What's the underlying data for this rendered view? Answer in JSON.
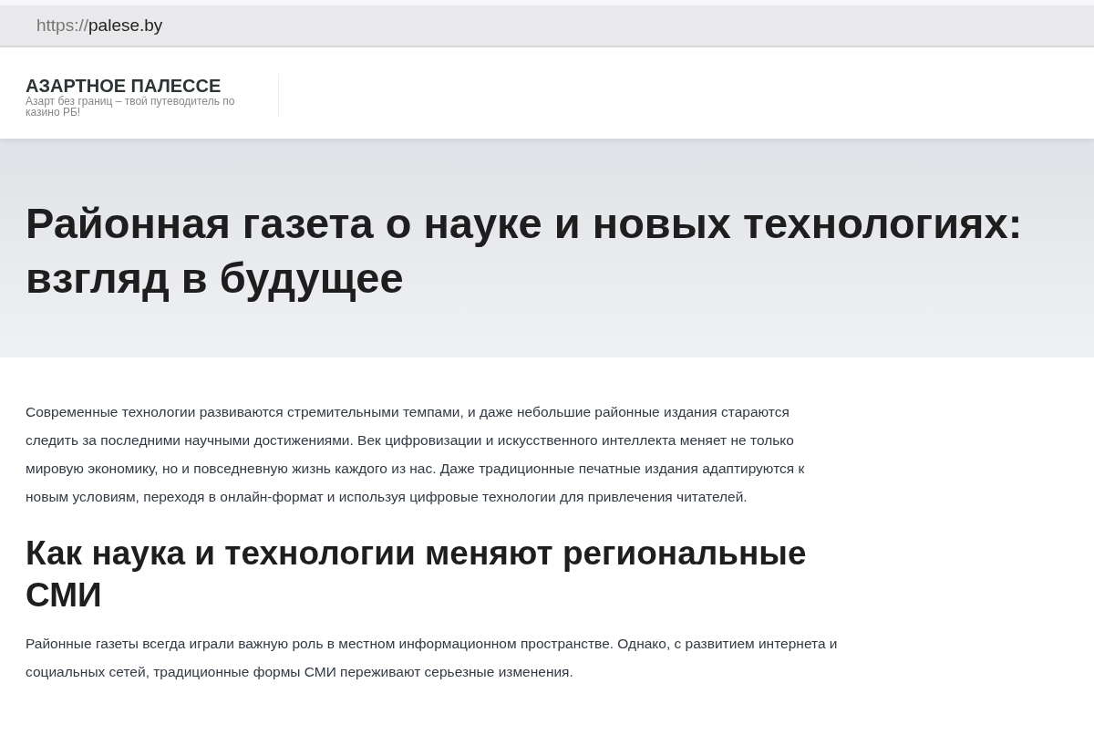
{
  "address_bar": {
    "scheme": "https://",
    "host": "palese.by"
  },
  "site_header": {
    "title": "АЗАРТНОЕ ПАЛЕССЕ",
    "tagline": "Азарт без границ – твой путеводитель по казино РБ!"
  },
  "hero": {
    "title": "Районная газета о науке и новых технологиях: взгляд в будущее"
  },
  "article": [
    {
      "kind": "paragraph",
      "text": "Современные технологии развиваются стремительными темпами, и даже небольшие районные издания стараются следить за последними научными достижениями. Век цифровизации и искусственного интеллекта меняет не только мировую экономику, но и повседневную жизнь каждого из нас. Даже традиционные печатные издания адаптируются к новым условиям, переходя в онлайн-формат и используя цифровые технологии для привлечения читателей."
    },
    {
      "kind": "heading",
      "text": "Как наука и технологии меняют региональные СМИ"
    },
    {
      "kind": "paragraph",
      "text": "Районные газеты всегда играли важную роль в местном информационном пространстве. Однако, с развитием интернета и социальных сетей, традиционные формы СМИ переживают серьезные изменения."
    }
  ]
}
